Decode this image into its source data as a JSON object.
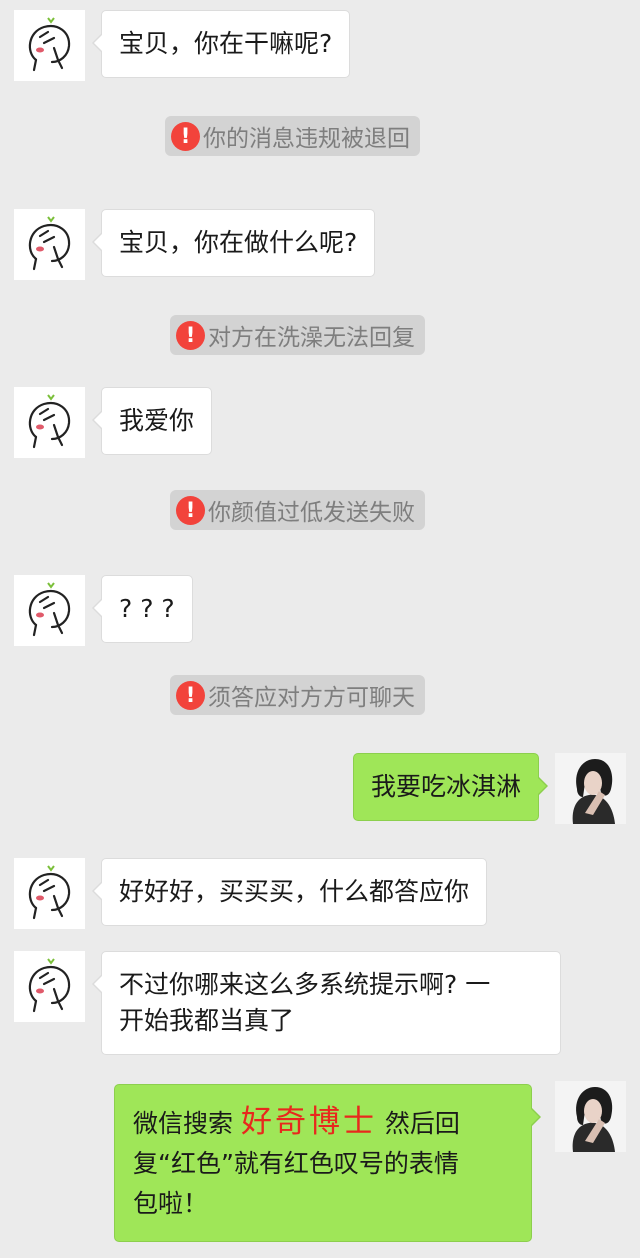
{
  "messages": [
    {
      "text": "宝贝，你在干嘛呢?"
    },
    {
      "notice": "你的消息违规被退回"
    },
    {
      "text": "宝贝，你在做什么呢?"
    },
    {
      "notice": "对方在洗澡无法回复"
    },
    {
      "text": "我爱你"
    },
    {
      "notice": "你颜值过低发送失败"
    },
    {
      "text": "? ? ?"
    },
    {
      "notice": "须答应对方方可聊天"
    },
    {
      "text": "我要吃冰淇淋"
    },
    {
      "text": "好好好，买买买，什么都答应你"
    },
    {
      "line1": "不过你哪来这么多系统提示啊? 一",
      "line2": "开始我都当真了"
    },
    {
      "pre": "微信搜索 ",
      "highlight": "好奇博士",
      "post": " 然后回",
      "line2": "复“红色”就有红色叹号的表情",
      "line3": "包啦！"
    }
  ],
  "warning_glyph": "!",
  "icons": {
    "left_avatar": "doodle-face-avatar",
    "right_avatar": "woman-photo-avatar",
    "warning": "red-exclamation-icon"
  },
  "colors": {
    "background": "#ebebeb",
    "right_bubble": "#9fe658",
    "warning": "#f2433b",
    "highlight": "#e8281d"
  }
}
